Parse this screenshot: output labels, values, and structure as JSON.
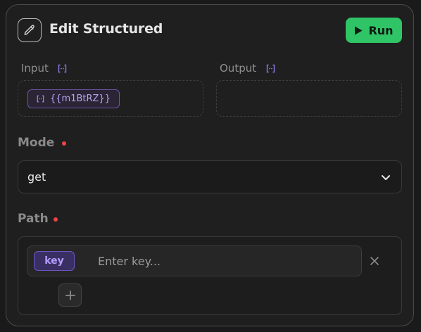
{
  "header": {
    "title": "Edit Structured",
    "title_icon": "pencil-icon",
    "run_label": "Run",
    "run_icon": "play-icon",
    "run_color": "#2fc466"
  },
  "io": {
    "input_label": "Input",
    "output_label": "Output",
    "input_chip": "{{m1BtRZ}}",
    "var_icon": "variable-icon"
  },
  "mode": {
    "label": "Mode",
    "value": "get",
    "chevron_icon": "chevron-down-icon"
  },
  "path": {
    "label": "Path",
    "items": [
      {
        "badge": "key",
        "placeholder": "Enter key...",
        "value": ""
      }
    ],
    "remove_icon": "close-icon",
    "add_icon": "plus-icon"
  },
  "colors": {
    "required": "#ef4444",
    "accent_purple": "#6d55c4"
  }
}
